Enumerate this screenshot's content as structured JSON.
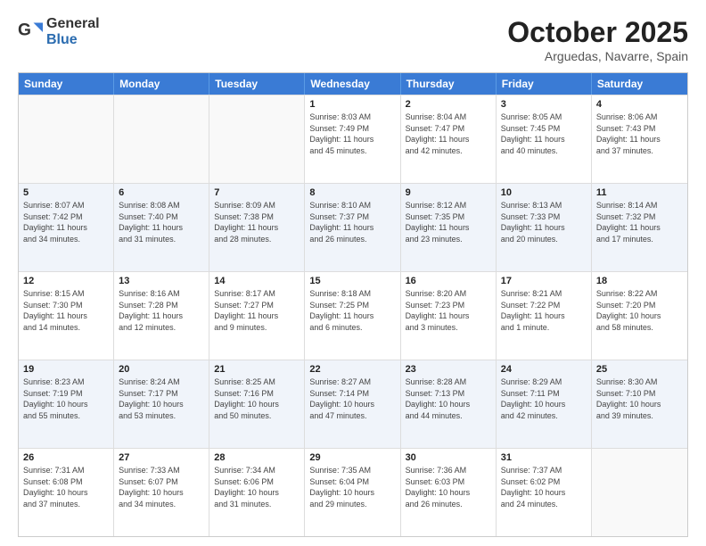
{
  "logo": {
    "general": "General",
    "blue": "Blue"
  },
  "header": {
    "month": "October 2025",
    "location": "Arguedas, Navarre, Spain"
  },
  "weekdays": [
    "Sunday",
    "Monday",
    "Tuesday",
    "Wednesday",
    "Thursday",
    "Friday",
    "Saturday"
  ],
  "rows": [
    {
      "alt": false,
      "cells": [
        {
          "day": "",
          "info": ""
        },
        {
          "day": "",
          "info": ""
        },
        {
          "day": "",
          "info": ""
        },
        {
          "day": "1",
          "info": "Sunrise: 8:03 AM\nSunset: 7:49 PM\nDaylight: 11 hours\nand 45 minutes."
        },
        {
          "day": "2",
          "info": "Sunrise: 8:04 AM\nSunset: 7:47 PM\nDaylight: 11 hours\nand 42 minutes."
        },
        {
          "day": "3",
          "info": "Sunrise: 8:05 AM\nSunset: 7:45 PM\nDaylight: 11 hours\nand 40 minutes."
        },
        {
          "day": "4",
          "info": "Sunrise: 8:06 AM\nSunset: 7:43 PM\nDaylight: 11 hours\nand 37 minutes."
        }
      ]
    },
    {
      "alt": true,
      "cells": [
        {
          "day": "5",
          "info": "Sunrise: 8:07 AM\nSunset: 7:42 PM\nDaylight: 11 hours\nand 34 minutes."
        },
        {
          "day": "6",
          "info": "Sunrise: 8:08 AM\nSunset: 7:40 PM\nDaylight: 11 hours\nand 31 minutes."
        },
        {
          "day": "7",
          "info": "Sunrise: 8:09 AM\nSunset: 7:38 PM\nDaylight: 11 hours\nand 28 minutes."
        },
        {
          "day": "8",
          "info": "Sunrise: 8:10 AM\nSunset: 7:37 PM\nDaylight: 11 hours\nand 26 minutes."
        },
        {
          "day": "9",
          "info": "Sunrise: 8:12 AM\nSunset: 7:35 PM\nDaylight: 11 hours\nand 23 minutes."
        },
        {
          "day": "10",
          "info": "Sunrise: 8:13 AM\nSunset: 7:33 PM\nDaylight: 11 hours\nand 20 minutes."
        },
        {
          "day": "11",
          "info": "Sunrise: 8:14 AM\nSunset: 7:32 PM\nDaylight: 11 hours\nand 17 minutes."
        }
      ]
    },
    {
      "alt": false,
      "cells": [
        {
          "day": "12",
          "info": "Sunrise: 8:15 AM\nSunset: 7:30 PM\nDaylight: 11 hours\nand 14 minutes."
        },
        {
          "day": "13",
          "info": "Sunrise: 8:16 AM\nSunset: 7:28 PM\nDaylight: 11 hours\nand 12 minutes."
        },
        {
          "day": "14",
          "info": "Sunrise: 8:17 AM\nSunset: 7:27 PM\nDaylight: 11 hours\nand 9 minutes."
        },
        {
          "day": "15",
          "info": "Sunrise: 8:18 AM\nSunset: 7:25 PM\nDaylight: 11 hours\nand 6 minutes."
        },
        {
          "day": "16",
          "info": "Sunrise: 8:20 AM\nSunset: 7:23 PM\nDaylight: 11 hours\nand 3 minutes."
        },
        {
          "day": "17",
          "info": "Sunrise: 8:21 AM\nSunset: 7:22 PM\nDaylight: 11 hours\nand 1 minute."
        },
        {
          "day": "18",
          "info": "Sunrise: 8:22 AM\nSunset: 7:20 PM\nDaylight: 10 hours\nand 58 minutes."
        }
      ]
    },
    {
      "alt": true,
      "cells": [
        {
          "day": "19",
          "info": "Sunrise: 8:23 AM\nSunset: 7:19 PM\nDaylight: 10 hours\nand 55 minutes."
        },
        {
          "day": "20",
          "info": "Sunrise: 8:24 AM\nSunset: 7:17 PM\nDaylight: 10 hours\nand 53 minutes."
        },
        {
          "day": "21",
          "info": "Sunrise: 8:25 AM\nSunset: 7:16 PM\nDaylight: 10 hours\nand 50 minutes."
        },
        {
          "day": "22",
          "info": "Sunrise: 8:27 AM\nSunset: 7:14 PM\nDaylight: 10 hours\nand 47 minutes."
        },
        {
          "day": "23",
          "info": "Sunrise: 8:28 AM\nSunset: 7:13 PM\nDaylight: 10 hours\nand 44 minutes."
        },
        {
          "day": "24",
          "info": "Sunrise: 8:29 AM\nSunset: 7:11 PM\nDaylight: 10 hours\nand 42 minutes."
        },
        {
          "day": "25",
          "info": "Sunrise: 8:30 AM\nSunset: 7:10 PM\nDaylight: 10 hours\nand 39 minutes."
        }
      ]
    },
    {
      "alt": false,
      "cells": [
        {
          "day": "26",
          "info": "Sunrise: 7:31 AM\nSunset: 6:08 PM\nDaylight: 10 hours\nand 37 minutes."
        },
        {
          "day": "27",
          "info": "Sunrise: 7:33 AM\nSunset: 6:07 PM\nDaylight: 10 hours\nand 34 minutes."
        },
        {
          "day": "28",
          "info": "Sunrise: 7:34 AM\nSunset: 6:06 PM\nDaylight: 10 hours\nand 31 minutes."
        },
        {
          "day": "29",
          "info": "Sunrise: 7:35 AM\nSunset: 6:04 PM\nDaylight: 10 hours\nand 29 minutes."
        },
        {
          "day": "30",
          "info": "Sunrise: 7:36 AM\nSunset: 6:03 PM\nDaylight: 10 hours\nand 26 minutes."
        },
        {
          "day": "31",
          "info": "Sunrise: 7:37 AM\nSunset: 6:02 PM\nDaylight: 10 hours\nand 24 minutes."
        },
        {
          "day": "",
          "info": ""
        }
      ]
    }
  ]
}
